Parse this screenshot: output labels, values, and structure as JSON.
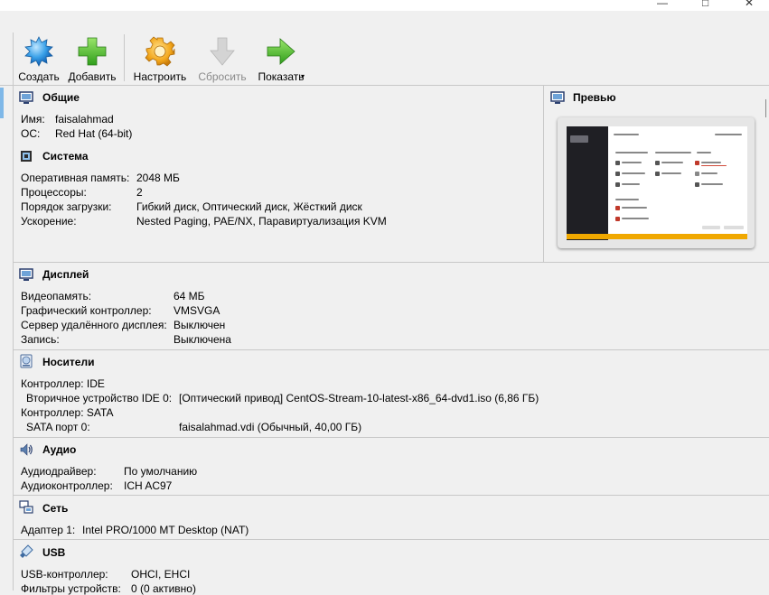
{
  "window": {
    "controls": [
      "—",
      "□",
      "✕"
    ]
  },
  "toolbar": {
    "create": "Создать",
    "add": "Добавить",
    "settings": "Настроить",
    "discard": "Сбросить",
    "show": "Показать"
  },
  "general": {
    "title": "Общие",
    "rows": [
      {
        "label": "Имя:",
        "value": "faisalahmad"
      },
      {
        "label": "ОС:",
        "value": "Red Hat (64-bit)"
      }
    ]
  },
  "system": {
    "title": "Система",
    "rows": [
      {
        "label": "Оперативная память:",
        "value": "2048 МБ"
      },
      {
        "label": "Процессоры:",
        "value": "2"
      },
      {
        "label": "Порядок загрузки:",
        "value": "Гибкий диск, Оптический диск, Жёсткий диск"
      },
      {
        "label": "Ускорение:",
        "value": "Nested Paging, PAE/NX, Паравиртуализация KVM"
      }
    ]
  },
  "preview": {
    "title": "Превью"
  },
  "display": {
    "title": "Дисплей",
    "rows": [
      {
        "label": "Видеопамять:",
        "value": "64 МБ"
      },
      {
        "label": "Графический контроллер:",
        "value": "VMSVGA"
      },
      {
        "label": "Сервер удалённого дисплея:",
        "value": "Выключен"
      },
      {
        "label": "Запись:",
        "value": "Выключена"
      }
    ]
  },
  "storage": {
    "title": "Носители",
    "rows": [
      {
        "label": "Контроллер: IDE",
        "value": ""
      },
      {
        "label": "Вторичное устройство IDE 0:",
        "value": "[Оптический привод] CentOS-Stream-10-latest-x86_64-dvd1.iso (6,86 ГБ)"
      },
      {
        "label": "Контроллер: SATA",
        "value": ""
      },
      {
        "label": "SATA порт 0:",
        "value": "faisalahmad.vdi (Обычный, 40,00 ГБ)"
      }
    ]
  },
  "audio": {
    "title": "Аудио",
    "rows": [
      {
        "label": "Аудиодрайвер:",
        "value": "По умолчанию"
      },
      {
        "label": "Аудиоконтроллер:",
        "value": "ICH AC97"
      }
    ]
  },
  "network": {
    "title": "Сеть",
    "rows": [
      {
        "label": "Адаптер 1:",
        "value": "Intel PRO/1000 MT Desktop (NAT)"
      }
    ]
  },
  "usb": {
    "title": "USB",
    "rows": [
      {
        "label": "USB-контроллер:",
        "value": "OHCI, EHCI"
      },
      {
        "label": "Фильтры устройств:",
        "value": "0 (0 активно)"
      }
    ]
  }
}
